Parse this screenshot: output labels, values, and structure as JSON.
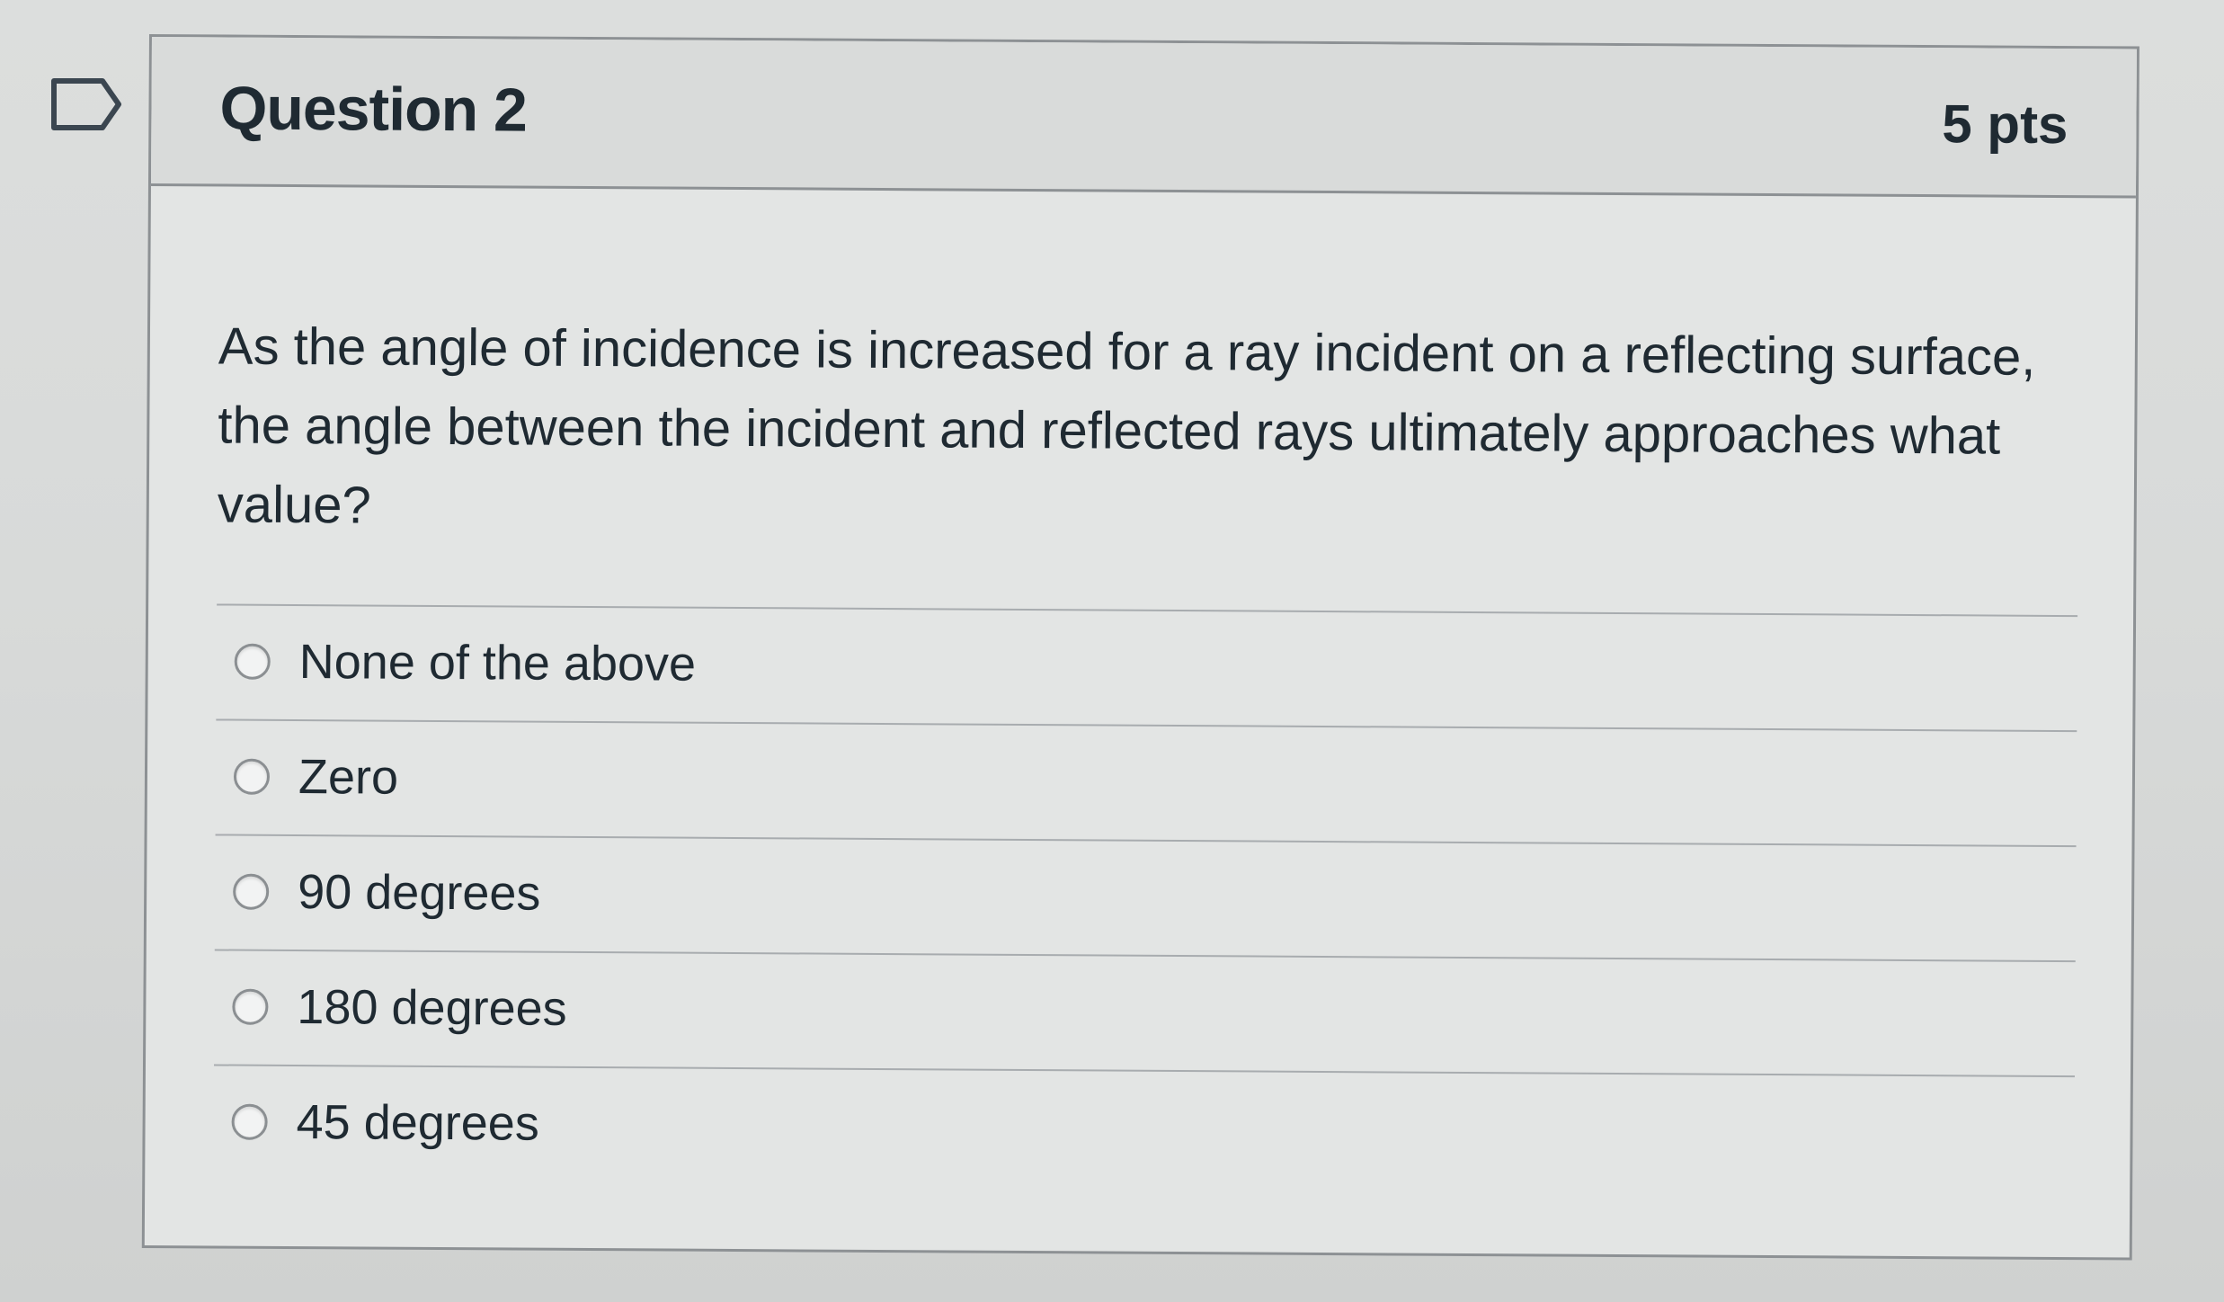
{
  "quiz": {
    "question": {
      "title": "Question 2",
      "points": "5 pts",
      "text": "As the angle of incidence is increased for a ray incident on a reflecting surface, the angle between the incident and reflected rays ultimately approaches what value?"
    },
    "answers": [
      {
        "label": "None of the above"
      },
      {
        "label": "Zero"
      },
      {
        "label": "90 degrees"
      },
      {
        "label": "180 degrees"
      },
      {
        "label": "45 degrees"
      }
    ]
  },
  "icons": {
    "flag": "flag-outline-icon",
    "radio": "radio-unselected-icon"
  },
  "colors": {
    "text": "#1f2a32",
    "border": "#8d9194",
    "header_bg": "#d9dbda",
    "card_bg": "#e3e5e4"
  }
}
